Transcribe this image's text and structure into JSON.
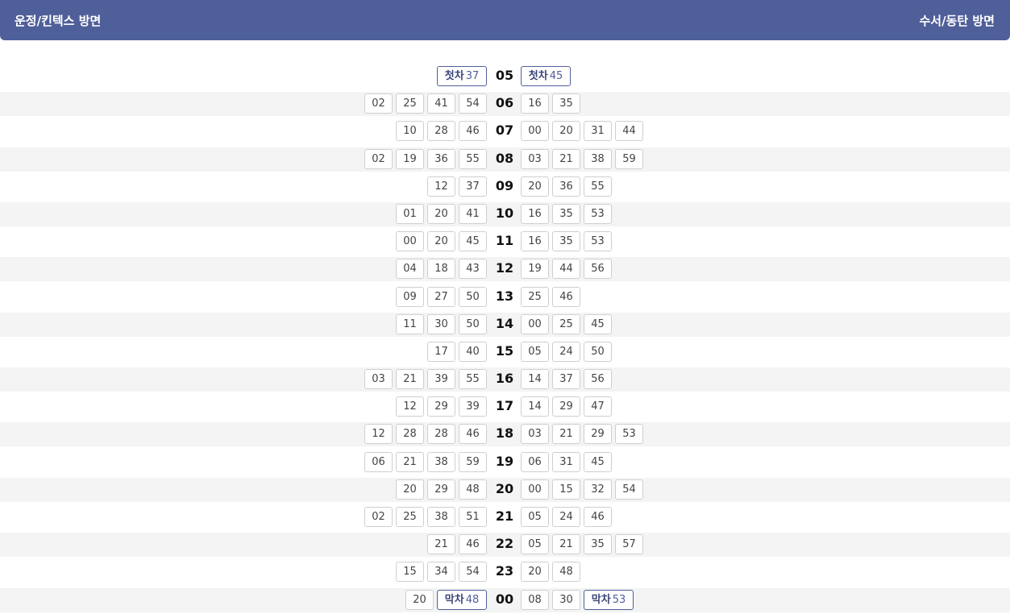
{
  "header": {
    "left_title": "운정/킨텍스 방면",
    "right_title": "수서/동탄 방면"
  },
  "first_label": "첫차",
  "last_label": "막차",
  "rows": [
    {
      "hour": "05",
      "left": [
        {
          "min": "37",
          "tag": "first"
        }
      ],
      "right": [
        {
          "min": "45",
          "tag": "first"
        }
      ]
    },
    {
      "hour": "06",
      "left": [
        {
          "min": "02"
        },
        {
          "min": "25"
        },
        {
          "min": "41"
        },
        {
          "min": "54"
        }
      ],
      "right": [
        {
          "min": "16"
        },
        {
          "min": "35"
        }
      ]
    },
    {
      "hour": "07",
      "left": [
        {
          "min": "10"
        },
        {
          "min": "28"
        },
        {
          "min": "46"
        }
      ],
      "right": [
        {
          "min": "00"
        },
        {
          "min": "20"
        },
        {
          "min": "31"
        },
        {
          "min": "44"
        }
      ]
    },
    {
      "hour": "08",
      "left": [
        {
          "min": "02"
        },
        {
          "min": "19"
        },
        {
          "min": "36"
        },
        {
          "min": "55"
        }
      ],
      "right": [
        {
          "min": "03"
        },
        {
          "min": "21"
        },
        {
          "min": "38"
        },
        {
          "min": "59"
        }
      ]
    },
    {
      "hour": "09",
      "left": [
        {
          "min": "12"
        },
        {
          "min": "37"
        }
      ],
      "right": [
        {
          "min": "20"
        },
        {
          "min": "36"
        },
        {
          "min": "55"
        }
      ]
    },
    {
      "hour": "10",
      "left": [
        {
          "min": "01"
        },
        {
          "min": "20"
        },
        {
          "min": "41"
        }
      ],
      "right": [
        {
          "min": "16"
        },
        {
          "min": "35"
        },
        {
          "min": "53"
        }
      ]
    },
    {
      "hour": "11",
      "left": [
        {
          "min": "00"
        },
        {
          "min": "20"
        },
        {
          "min": "45"
        }
      ],
      "right": [
        {
          "min": "16"
        },
        {
          "min": "35"
        },
        {
          "min": "53"
        }
      ]
    },
    {
      "hour": "12",
      "left": [
        {
          "min": "04"
        },
        {
          "min": "18"
        },
        {
          "min": "43"
        }
      ],
      "right": [
        {
          "min": "19"
        },
        {
          "min": "44"
        },
        {
          "min": "56"
        }
      ]
    },
    {
      "hour": "13",
      "left": [
        {
          "min": "09"
        },
        {
          "min": "27"
        },
        {
          "min": "50"
        }
      ],
      "right": [
        {
          "min": "25"
        },
        {
          "min": "46"
        }
      ]
    },
    {
      "hour": "14",
      "left": [
        {
          "min": "11"
        },
        {
          "min": "30"
        },
        {
          "min": "50"
        }
      ],
      "right": [
        {
          "min": "00"
        },
        {
          "min": "25"
        },
        {
          "min": "45"
        }
      ]
    },
    {
      "hour": "15",
      "left": [
        {
          "min": "17"
        },
        {
          "min": "40"
        }
      ],
      "right": [
        {
          "min": "05"
        },
        {
          "min": "24"
        },
        {
          "min": "50"
        }
      ]
    },
    {
      "hour": "16",
      "left": [
        {
          "min": "03"
        },
        {
          "min": "21"
        },
        {
          "min": "39"
        },
        {
          "min": "55"
        }
      ],
      "right": [
        {
          "min": "14"
        },
        {
          "min": "37"
        },
        {
          "min": "56"
        }
      ]
    },
    {
      "hour": "17",
      "left": [
        {
          "min": "12"
        },
        {
          "min": "29"
        },
        {
          "min": "39"
        }
      ],
      "right": [
        {
          "min": "14"
        },
        {
          "min": "29"
        },
        {
          "min": "47"
        }
      ]
    },
    {
      "hour": "18",
      "left": [
        {
          "min": "12"
        },
        {
          "min": "28"
        },
        {
          "min": "28"
        },
        {
          "min": "46"
        }
      ],
      "right": [
        {
          "min": "03"
        },
        {
          "min": "21"
        },
        {
          "min": "29"
        },
        {
          "min": "53"
        }
      ]
    },
    {
      "hour": "19",
      "left": [
        {
          "min": "06"
        },
        {
          "min": "21"
        },
        {
          "min": "38"
        },
        {
          "min": "59"
        }
      ],
      "right": [
        {
          "min": "06"
        },
        {
          "min": "31"
        },
        {
          "min": "45"
        }
      ]
    },
    {
      "hour": "20",
      "left": [
        {
          "min": "20"
        },
        {
          "min": "29"
        },
        {
          "min": "48"
        }
      ],
      "right": [
        {
          "min": "00"
        },
        {
          "min": "15"
        },
        {
          "min": "32"
        },
        {
          "min": "54"
        }
      ]
    },
    {
      "hour": "21",
      "left": [
        {
          "min": "02"
        },
        {
          "min": "25"
        },
        {
          "min": "38"
        },
        {
          "min": "51"
        }
      ],
      "right": [
        {
          "min": "05"
        },
        {
          "min": "24"
        },
        {
          "min": "46"
        }
      ]
    },
    {
      "hour": "22",
      "left": [
        {
          "min": "21"
        },
        {
          "min": "46"
        }
      ],
      "right": [
        {
          "min": "05"
        },
        {
          "min": "21"
        },
        {
          "min": "35"
        },
        {
          "min": "57"
        }
      ]
    },
    {
      "hour": "23",
      "left": [
        {
          "min": "15"
        },
        {
          "min": "34"
        },
        {
          "min": "54"
        }
      ],
      "right": [
        {
          "min": "20"
        },
        {
          "min": "48"
        }
      ]
    },
    {
      "hour": "00",
      "left": [
        {
          "min": "20"
        },
        {
          "min": "48",
          "tag": "last"
        }
      ],
      "right": [
        {
          "min": "08"
        },
        {
          "min": "30"
        },
        {
          "min": "53",
          "tag": "last"
        }
      ]
    }
  ]
}
